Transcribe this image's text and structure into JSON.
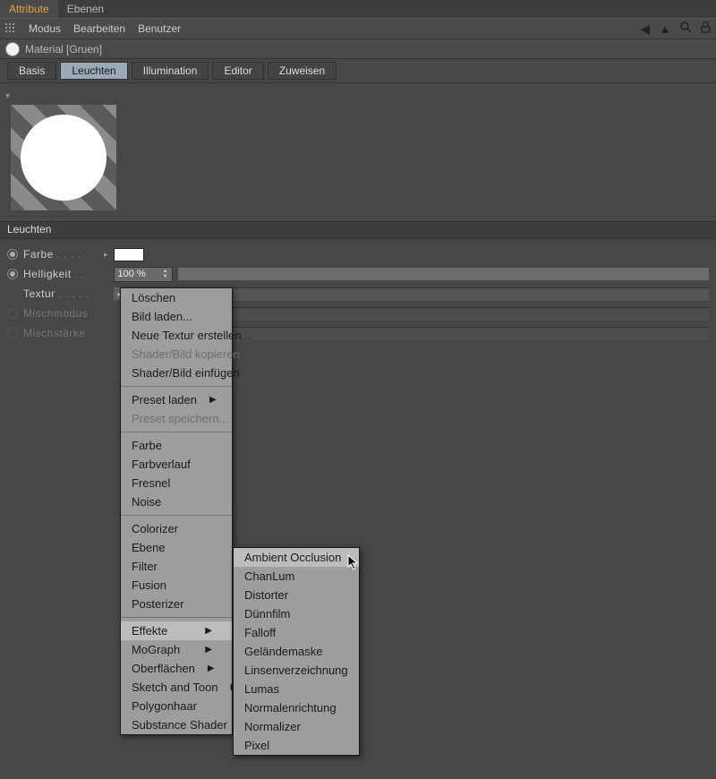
{
  "tabs": {
    "attribute": "Attribute",
    "ebenen": "Ebenen"
  },
  "toolbar": {
    "modus": "Modus",
    "bearbeiten": "Bearbeiten",
    "benutzer": "Benutzer"
  },
  "material": {
    "title": "Material [Gruen]"
  },
  "channels": {
    "basis": "Basis",
    "leuchten": "Leuchten",
    "illumination": "Illumination",
    "editor": "Editor",
    "zuweisen": "Zuweisen"
  },
  "section": "Leuchten",
  "params": {
    "farbe": "Farbe",
    "helligkeit": "Helligkeit",
    "helligkeit_val": "100 %",
    "textur": "Textur",
    "mischmodus": "Mischmodus",
    "mischstaerke": "Mischstärke"
  },
  "menu1": {
    "items": [
      {
        "label": "Löschen"
      },
      {
        "label": "Bild laden..."
      },
      {
        "label": "Neue Textur erstellen..."
      },
      {
        "label": "Shader/Bild kopieren",
        "disabled": true
      },
      {
        "label": "Shader/Bild einfügen"
      },
      {
        "sep": true
      },
      {
        "label": "Preset laden",
        "sub": true
      },
      {
        "label": "Preset speichern...",
        "disabled": true
      },
      {
        "sep": true
      },
      {
        "label": "Farbe"
      },
      {
        "label": "Farbverlauf"
      },
      {
        "label": "Fresnel"
      },
      {
        "label": "Noise"
      },
      {
        "sep": true
      },
      {
        "label": "Colorizer"
      },
      {
        "label": "Ebene"
      },
      {
        "label": "Filter"
      },
      {
        "label": "Fusion"
      },
      {
        "label": "Posterizer"
      },
      {
        "sep": true
      },
      {
        "label": "Effekte",
        "sub": true,
        "hover": true
      },
      {
        "label": "MoGraph",
        "sub": true
      },
      {
        "label": "Oberflächen",
        "sub": true
      },
      {
        "label": "Sketch and Toon",
        "sub": true
      },
      {
        "label": "Polygonhaar"
      },
      {
        "label": "Substance Shader"
      }
    ]
  },
  "menu2": {
    "items": [
      {
        "label": "Ambient Occlusion",
        "hover": true
      },
      {
        "label": "ChanLum"
      },
      {
        "label": "Distorter"
      },
      {
        "label": "Dünnfilm"
      },
      {
        "label": "Falloff"
      },
      {
        "label": "Geländemaske"
      },
      {
        "label": "Linsenverzeichnung"
      },
      {
        "label": "Lumas"
      },
      {
        "label": "Normalenrichtung"
      },
      {
        "label": "Normalizer"
      },
      {
        "label": "Pixel"
      }
    ]
  }
}
